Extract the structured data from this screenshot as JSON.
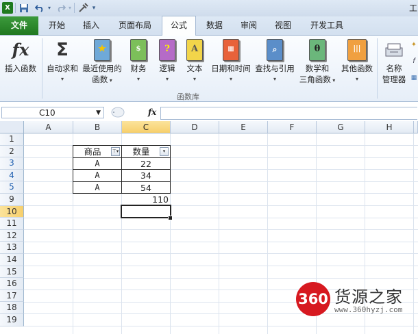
{
  "title_fragment": "工",
  "ribbon_tabs": [
    "文件",
    "开始",
    "插入",
    "页面布局",
    "公式",
    "数据",
    "审阅",
    "视图",
    "开发工具"
  ],
  "active_tab": "公式",
  "ribbon_buttons": {
    "insert_function": "插入函数",
    "autosum": "自动求和",
    "recently_used": {
      "line1": "最近使用的",
      "line2": "函数"
    },
    "financial": "财务",
    "logical": "逻辑",
    "text": "文本",
    "date_time": "日期和时间",
    "lookup_ref": "查找与引用",
    "math_trig": {
      "line1": "数学和",
      "line2": "三角函数"
    },
    "more_functions": "其他函数",
    "name_manager": {
      "line1": "名称",
      "line2": "管理器"
    }
  },
  "ribbon_group_label": "函数库",
  "formula_bar": {
    "name_box": "C10",
    "fx": "fx",
    "formula": ""
  },
  "columns": [
    "A",
    "B",
    "C",
    "D",
    "E",
    "F",
    "G",
    "H"
  ],
  "selected_column": "C",
  "rows": [
    "1",
    "2",
    "3",
    "4",
    "5",
    "9",
    "10",
    "11",
    "12",
    "13",
    "14",
    "15",
    "16",
    "17",
    "18",
    "19"
  ],
  "selected_row": "10",
  "table": {
    "headers": [
      "商品",
      "数量"
    ],
    "rows": [
      [
        "A",
        "22"
      ],
      [
        "A",
        "34"
      ],
      [
        "A",
        "54"
      ]
    ]
  },
  "sum_value": "110",
  "watermark": {
    "logo": "360",
    "name": "货源之家",
    "url": "www.360hyzj.com"
  }
}
